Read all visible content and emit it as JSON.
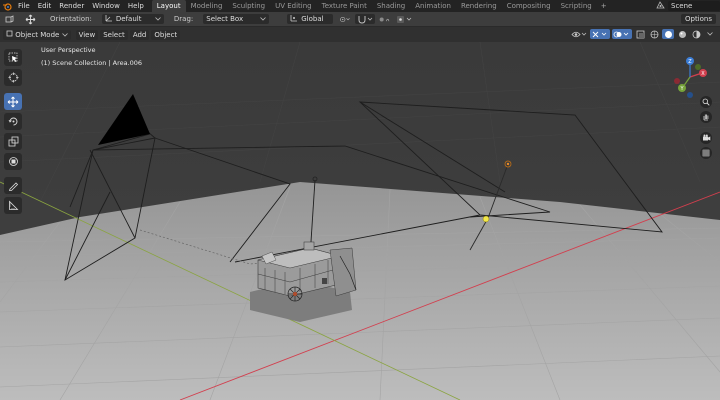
{
  "menu": {
    "items": [
      "File",
      "Edit",
      "Render",
      "Window",
      "Help"
    ]
  },
  "workspaces": [
    "Layout",
    "Modeling",
    "Sculpting",
    "UV Editing",
    "Texture Paint",
    "Shading",
    "Animation",
    "Rendering",
    "Compositing",
    "Scripting"
  ],
  "workspace_add": "+",
  "scene": {
    "name": "Scene"
  },
  "tool_header": {
    "orientation_label": "Orientation:",
    "orientation_value": "Default",
    "drag_label": "Drag:",
    "drag_value": "Select Box",
    "transform_orientation": "Global",
    "options_label": "Options"
  },
  "viewport_header": {
    "mode": "Object Mode",
    "menus": [
      "View",
      "Select",
      "Add",
      "Object"
    ]
  },
  "viewport": {
    "perspective_label": "User Perspective",
    "collection_label": "(1) Scene Collection | Area.006"
  },
  "gizmo": {
    "x": "X",
    "y": "Y",
    "z": "Z"
  },
  "colors": {
    "x_axis": "#d23f4e",
    "y_axis": "#76a33a",
    "z_axis": "#3b7dd6",
    "active_tool": "#4772b3",
    "light": "#f2e84a"
  }
}
